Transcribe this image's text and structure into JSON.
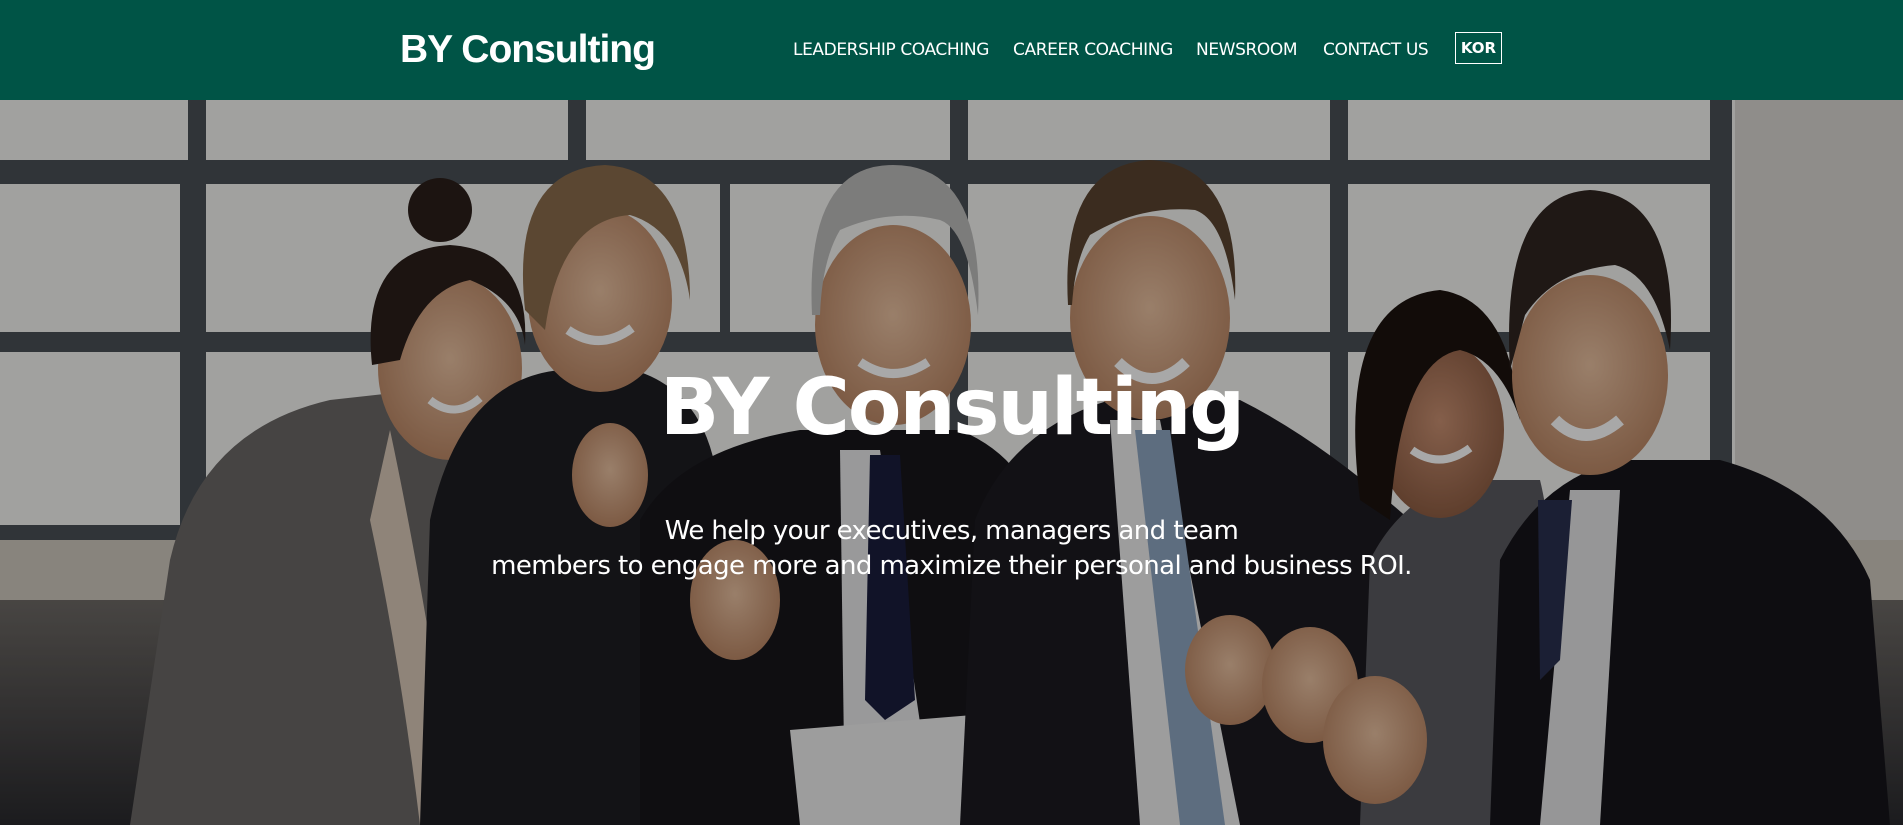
{
  "header": {
    "logo": "BY Consulting",
    "nav": [
      {
        "label": "LEADERSHIP COACHING"
      },
      {
        "label": "CAREER COACHING"
      },
      {
        "label": "NEWSROOM"
      },
      {
        "label": "CONTACT US"
      }
    ],
    "language_button": "KOR",
    "background_color": "#005446"
  },
  "hero": {
    "title": "BY Consulting",
    "subtitle_line1": "We help your executives, managers and team",
    "subtitle_line2": "members to engage more and maximize their personal and business ROI.",
    "image": "group of smiling business people celebrating in office"
  }
}
